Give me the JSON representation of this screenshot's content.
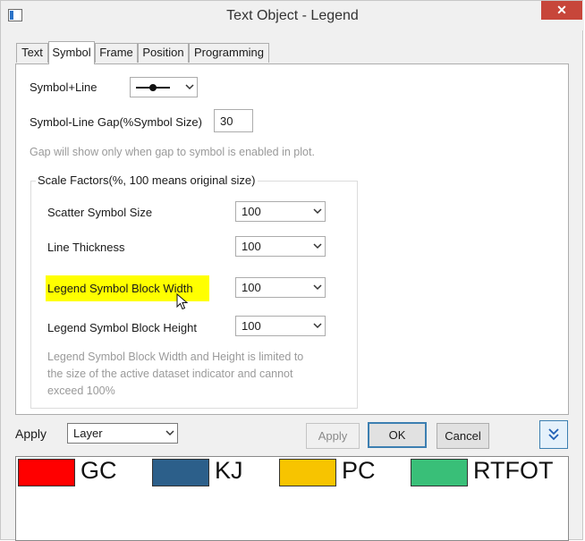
{
  "window": {
    "title": "Text Object - Legend",
    "close_glyph": "✕"
  },
  "tabs": [
    {
      "label": "Text"
    },
    {
      "label": "Symbol"
    },
    {
      "label": "Frame"
    },
    {
      "label": "Position"
    },
    {
      "label": "Programming"
    }
  ],
  "symbol_tab": {
    "symbol_line_label": "Symbol+Line",
    "gap_label": "Symbol-Line Gap(%Symbol Size)",
    "gap_value": "30",
    "gap_hint": "Gap will show only when gap to symbol is enabled in plot.",
    "scale_group_title": "Scale Factors(%, 100 means original size)",
    "scatter_label": "Scatter Symbol Size",
    "scatter_value": "100",
    "line_thickness_label": "Line Thickness",
    "line_thickness_value": "100",
    "block_width_label": "Legend Symbol Block Width",
    "block_width_value": "100",
    "block_height_label": "Legend Symbol Block Height",
    "block_height_value": "100",
    "limit_hint_1": "Legend Symbol Block Width and Height is limited to",
    "limit_hint_2": "the size of the active dataset indicator and cannot",
    "limit_hint_3": "exceed 100%"
  },
  "footer": {
    "apply_label": "Apply",
    "apply_scope": "Layer",
    "apply_button": "Apply",
    "ok_button": "OK",
    "cancel_button": "Cancel",
    "expand_icon": "double-chevron-down-icon"
  },
  "preview": {
    "items": [
      {
        "label": "GC",
        "color": "#ff0000"
      },
      {
        "label": "KJ",
        "color": "#2c5f8a"
      },
      {
        "label": "PC",
        "color": "#f7c400"
      },
      {
        "label": "RTFOT",
        "color": "#39bf78"
      }
    ]
  },
  "colors": {
    "highlight": "#ffff00",
    "accent": "#3c7fb1",
    "close": "#c7463a"
  }
}
